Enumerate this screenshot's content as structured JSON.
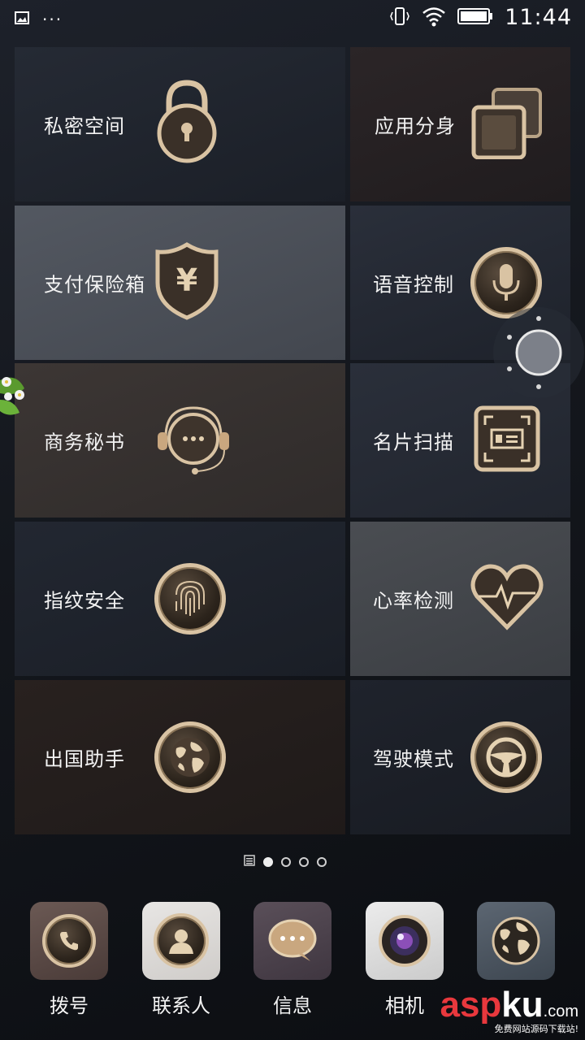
{
  "status_bar": {
    "time": "11:44",
    "left_icons": [
      "image-icon",
      "more-icon"
    ],
    "right_icons": [
      "vibrate-icon",
      "wifi-icon",
      "battery-icon"
    ]
  },
  "tiles": [
    {
      "label": "私密空间",
      "icon": "lock-icon"
    },
    {
      "label": "应用分身",
      "icon": "app-clone-icon"
    },
    {
      "label": "支付保险箱",
      "icon": "yuan-shield-icon"
    },
    {
      "label": "语音控制",
      "icon": "microphone-icon"
    },
    {
      "label": "商务秘书",
      "icon": "headset-icon"
    },
    {
      "label": "名片扫描",
      "icon": "card-scan-icon"
    },
    {
      "label": "指纹安全",
      "icon": "fingerprint-icon"
    },
    {
      "label": "心率检测",
      "icon": "heart-rate-icon"
    },
    {
      "label": "出国助手",
      "icon": "globe-icon"
    },
    {
      "label": "驾驶模式",
      "icon": "steering-wheel-icon"
    }
  ],
  "page_indicator": {
    "pages": 4,
    "active": 1,
    "has_list_icon": true
  },
  "dock": [
    {
      "label": "拨号",
      "icon": "phone-icon"
    },
    {
      "label": "联系人",
      "icon": "contact-icon"
    },
    {
      "label": "信息",
      "icon": "message-icon"
    },
    {
      "label": "相机",
      "icon": "camera-icon"
    },
    {
      "label": "",
      "icon": "world-map-icon"
    }
  ],
  "watermark": {
    "main_a": "asp",
    "main_b": "ku",
    "dotcom": ".com",
    "sub": "免费网站源码下载站!"
  },
  "colors": {
    "gold": "#d9c3a3",
    "accent_red": "#e8383d"
  }
}
